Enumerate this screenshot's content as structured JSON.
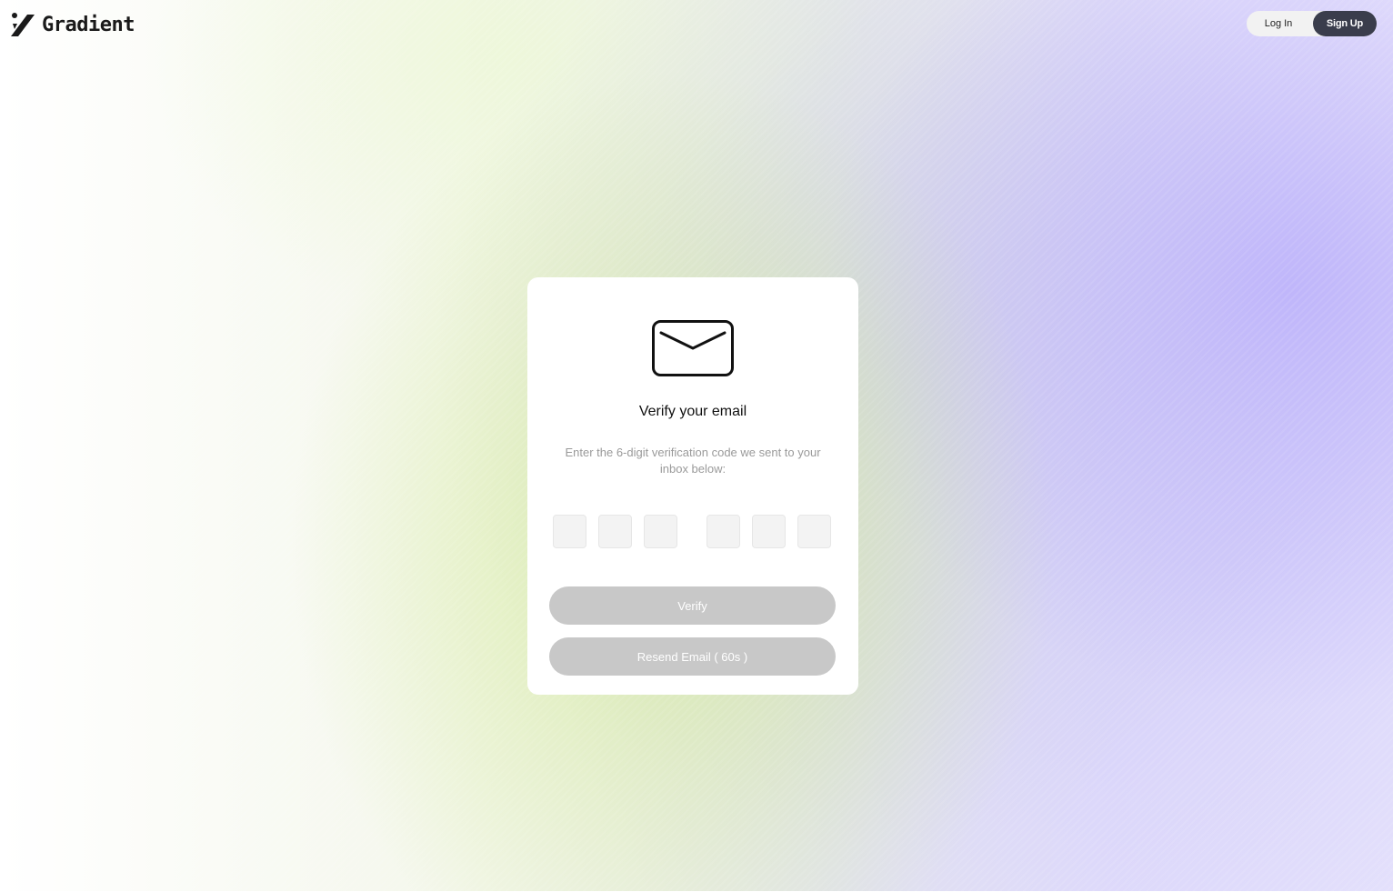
{
  "app": {
    "logo_text": "Gradient"
  },
  "header": {
    "login_label": "Log In",
    "signup_label": "Sign Up"
  },
  "card": {
    "icon": "envelope-icon",
    "title": "Verify your email",
    "subtitle": "Enter the 6-digit verification code we sent to your inbox below:",
    "code_digits": [
      "",
      "",
      "",
      "",
      "",
      ""
    ],
    "verify_label": "Verify",
    "resend_label": "Resend Email ( 60s )"
  },
  "colors": {
    "signup_bg": "#3a3d4c",
    "disabled_button": "#c8c8c8",
    "subtitle_text": "#9a9a9a"
  }
}
